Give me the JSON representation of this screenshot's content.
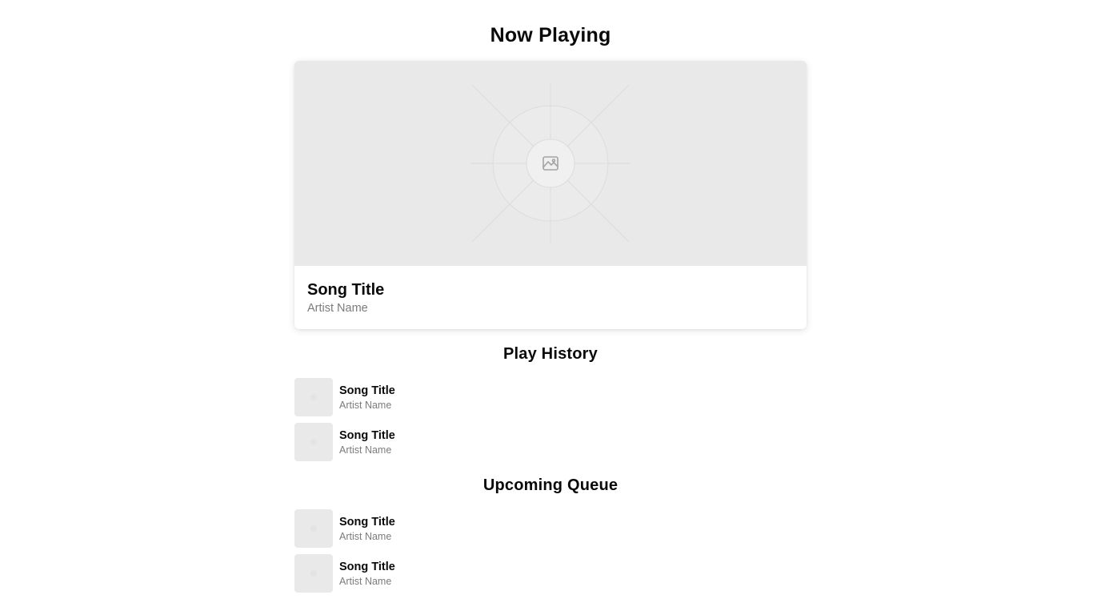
{
  "now_playing": {
    "heading": "Now Playing",
    "song_title": "Song Title",
    "artist_name": "Artist Name",
    "cover_icon": "image-placeholder-icon"
  },
  "play_history": {
    "heading": "Play History",
    "items": [
      {
        "title": "Song Title",
        "artist": "Artist Name"
      },
      {
        "title": "Song Title",
        "artist": "Artist Name"
      }
    ]
  },
  "upcoming_queue": {
    "heading": "Upcoming Queue",
    "items": [
      {
        "title": "Song Title",
        "artist": "Artist Name"
      },
      {
        "title": "Song Title",
        "artist": "Artist Name"
      }
    ]
  },
  "colors": {
    "placeholder_bg": "#e9e9e9",
    "muted_text": "#7b7b7b",
    "heading_text": "#0a0a0a"
  }
}
